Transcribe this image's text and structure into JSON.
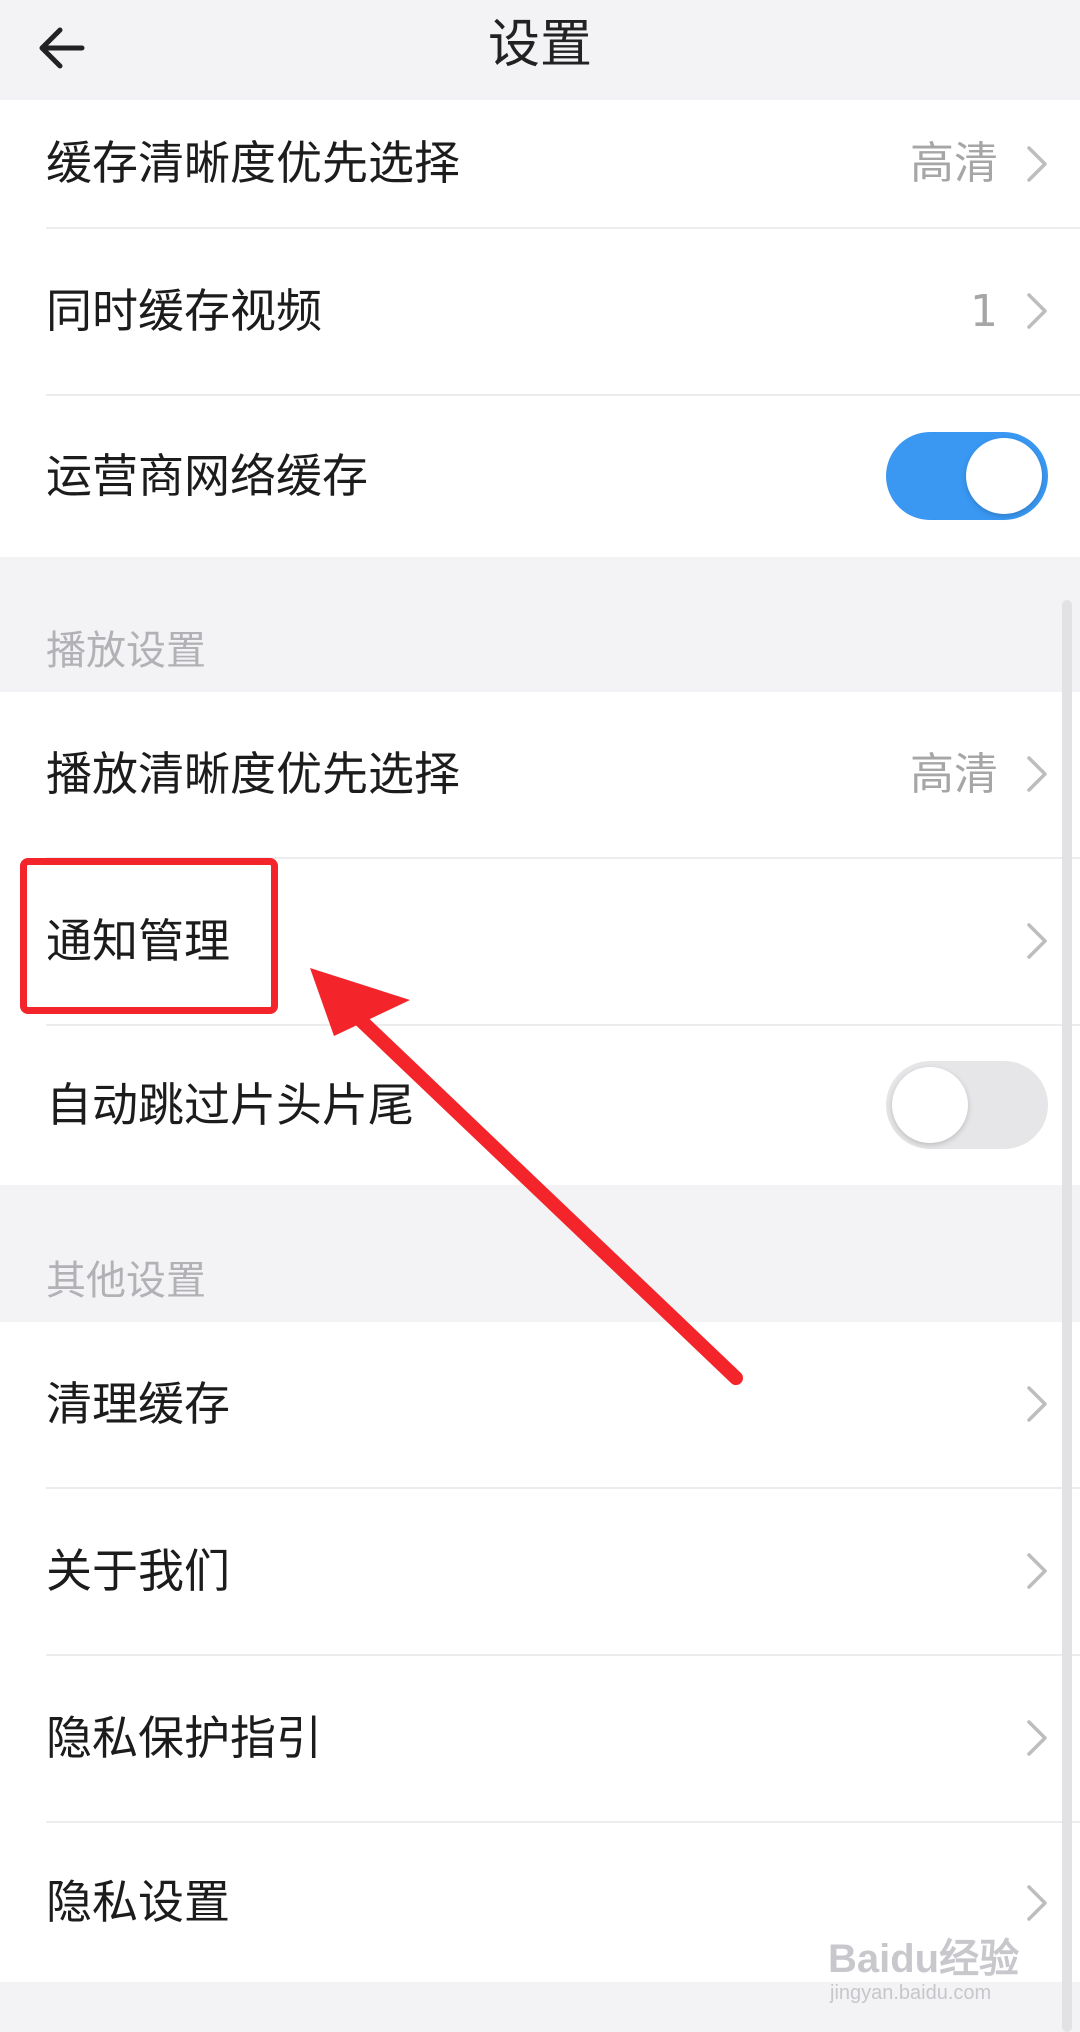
{
  "header": {
    "title": "设置"
  },
  "cache_group": {
    "items": [
      {
        "label": "缓存清晰度优先选择",
        "value": "高清"
      },
      {
        "label": "同时缓存视频",
        "value": "1"
      },
      {
        "label": "运营商网络缓存",
        "toggle_state": "on"
      }
    ]
  },
  "playback_section": {
    "title": "播放设置",
    "items": [
      {
        "label": "播放清晰度优先选择",
        "value": "高清"
      },
      {
        "label": "通知管理"
      },
      {
        "label": "自动跳过片头片尾",
        "toggle_state": "off"
      }
    ]
  },
  "other_section": {
    "title": "其他设置",
    "items": [
      {
        "label": "清理缓存"
      },
      {
        "label": "关于我们"
      },
      {
        "label": "隐私保护指引"
      },
      {
        "label": "隐私设置"
      }
    ]
  },
  "colors": {
    "toggle_on": "#3a98f2",
    "toggle_off": "#e6e6e8",
    "annotation_red": "#f4252a",
    "value_text": "#a6a6a6"
  },
  "icons": {
    "back": "arrow-left-icon",
    "chevron": "chevron-right-icon"
  },
  "watermark": {
    "brand": "Baidu经验",
    "url": "jingyan.baidu.com"
  }
}
